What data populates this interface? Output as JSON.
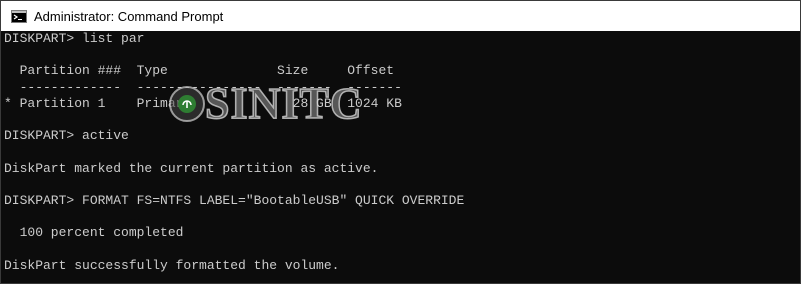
{
  "window": {
    "title": "Administrator: Command Prompt",
    "app_icon": "cmd-icon"
  },
  "console": {
    "lines": [
      "DISKPART> list par",
      "",
      "  Partition ###  Type              Size     Offset",
      "  -------------  ----------------  -------  -------",
      "* Partition 1    Primary             28 GB  1024 KB",
      "",
      "DISKPART> active",
      "",
      "DiskPart marked the current partition as active.",
      "",
      "DISKPART> FORMAT FS=NTFS LABEL=\"BootableUSB\" QUICK OVERRIDE",
      "",
      "  100 percent completed",
      "",
      "DiskPart successfully formatted the volume."
    ]
  },
  "watermark": {
    "text": "SINITC",
    "logo": "sinitc-logo"
  },
  "colors": {
    "console_background": "#0c0c0c",
    "console_text": "#cccccc",
    "titlebar_background": "#ffffff",
    "logo_green": "#2e7d32"
  }
}
